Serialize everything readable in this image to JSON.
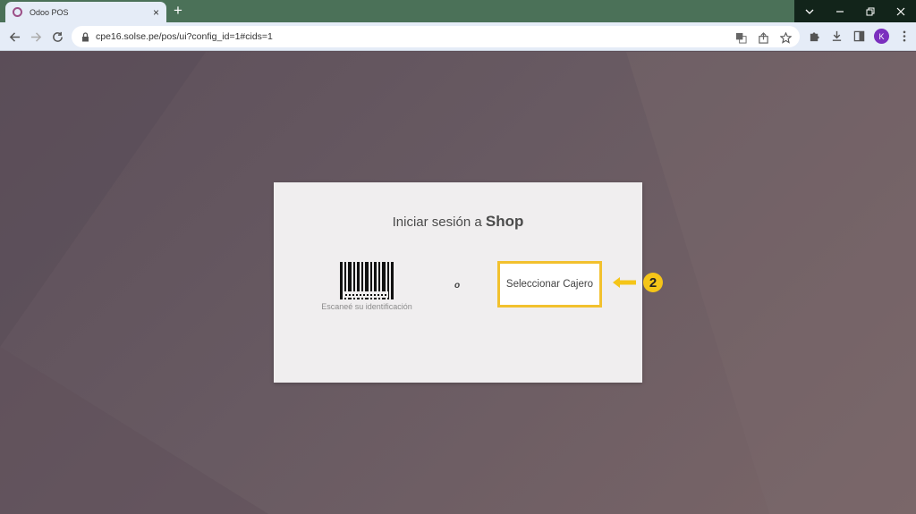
{
  "browser": {
    "tab_title": "Odoo POS",
    "tab_close": "×",
    "new_tab": "+",
    "url": "cpe16.solse.pe/pos/ui?config_id=1#cids=1",
    "profile_initial": "K"
  },
  "login": {
    "title_prefix": "Iniciar sesión a",
    "shop_name": "Shop",
    "scan_label": "Escaneé su identificación",
    "or_text": "o",
    "select_cashier_label": "Seleccionar Cajero"
  },
  "annotation": {
    "step_number": "2",
    "color": "#f5c518"
  },
  "colors": {
    "accent_highlight": "#f2c12e",
    "tabstrip": "#4b7158",
    "toolbar": "#e5ecf7"
  }
}
